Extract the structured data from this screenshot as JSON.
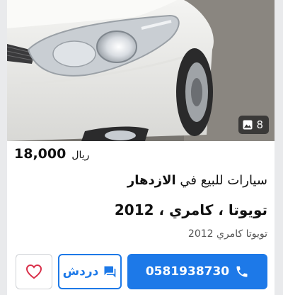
{
  "listing": {
    "photo_count": "8",
    "price": "18,000",
    "currency": "ريال",
    "title_prefix": "سيارات للبيع في",
    "title_location": "الازدهار",
    "car_title": "تويوتا ، كامري ، 2012",
    "car_model": "تويوتا كامري 2012"
  },
  "actions": {
    "phone_number": "0581938730",
    "chat_label": "دردش"
  },
  "colors": {
    "accent": "#1d79e8",
    "favorite": "#d9304a"
  },
  "icons": [
    "image-icon",
    "phone-icon",
    "chat-icon",
    "heart-icon"
  ]
}
